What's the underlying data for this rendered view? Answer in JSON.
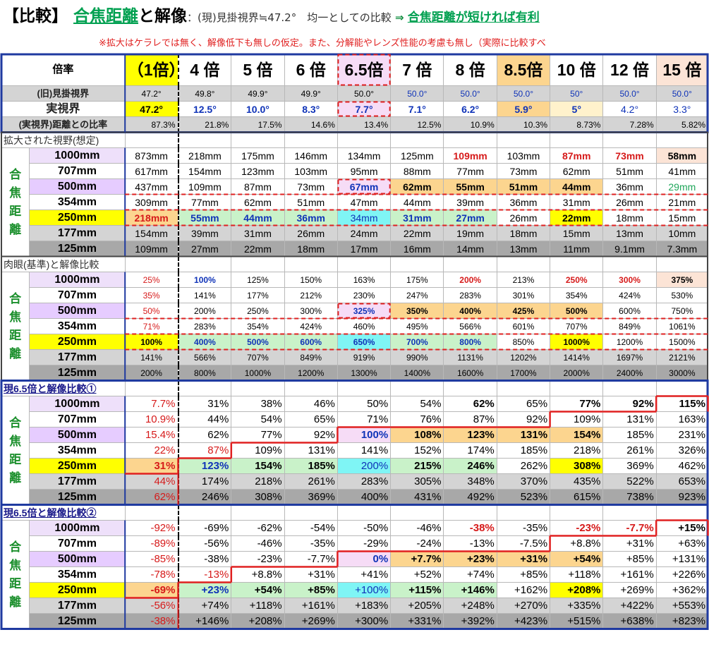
{
  "title": {
    "open": "【",
    "tag": "比較",
    "close": "】",
    "focal": "合焦距離",
    "and": "と",
    "res": "解像",
    "note": "：(現)見掛視界≒47.2°　均一としての比較",
    "arrow": " ⇒ ",
    "win": "合焦距離が短ければ有利"
  },
  "subtitle": "※拡大はケラレでは無く、解像低下も無しの仮定。また、分解能やレンズ性能の考慮も無し（実際に比較すべ",
  "colors": {
    "blue_frame": "#1f3aa0",
    "red_line": "#e02020",
    "green_label": "#1b8f2c"
  },
  "focal_label": [
    "合",
    "焦",
    "距",
    "離"
  ],
  "header": {
    "label": "倍率",
    "cols": [
      "（1倍）",
      "4 倍",
      "5 倍",
      "6 倍",
      "6.5倍",
      "7 倍",
      "8 倍",
      "8.5倍",
      "10 倍",
      "12 倍",
      "15 倍"
    ]
  },
  "info_rows": [
    {
      "label": "(旧)見掛視界",
      "cells": [
        "47.2°",
        "49.8°",
        "49.9°",
        "49.9°",
        "50.0°",
        "50.0°",
        "50.0°",
        "50.0°",
        "50°",
        "50.0°",
        "50.0°"
      ]
    },
    {
      "label": "実視界",
      "cells": [
        "47.2°",
        "12.5°",
        "10.0°",
        "8.3°",
        "7.7°",
        "7.1°",
        "6.2°",
        "5.9°",
        "5°",
        "4.2°",
        "3.3°"
      ]
    },
    {
      "label": "(実視界)距離との比率",
      "cells": [
        "87.3%",
        "21.8%",
        "17.5%",
        "14.6%",
        "13.4%",
        "12.5%",
        "10.9%",
        "10.3%",
        "8.73%",
        "7.28%",
        "5.82%"
      ]
    }
  ],
  "distances": [
    "1000mm",
    "707mm",
    "500mm",
    "354mm",
    "250mm",
    "177mm",
    "125mm"
  ],
  "sections": [
    {
      "title": "拡大された視野(想定)",
      "rows": [
        [
          "873mm",
          "218mm",
          "175mm",
          "146mm",
          "134mm",
          "125mm",
          "109mm",
          "103mm",
          "87mm",
          "73mm",
          "58mm"
        ],
        [
          "617mm",
          "154mm",
          "123mm",
          "103mm",
          "95mm",
          "88mm",
          "77mm",
          "73mm",
          "62mm",
          "51mm",
          "41mm"
        ],
        [
          "437mm",
          "109mm",
          "87mm",
          "73mm",
          "67mm",
          "62mm",
          "55mm",
          "51mm",
          "44mm",
          "36mm",
          "29mm"
        ],
        [
          "309mm",
          "77mm",
          "62mm",
          "51mm",
          "47mm",
          "44mm",
          "39mm",
          "36mm",
          "31mm",
          "26mm",
          "21mm"
        ],
        [
          "218mm",
          "55mm",
          "44mm",
          "36mm",
          "34mm",
          "31mm",
          "27mm",
          "26mm",
          "22mm",
          "18mm",
          "15mm"
        ],
        [
          "154mm",
          "39mm",
          "31mm",
          "26mm",
          "24mm",
          "22mm",
          "19mm",
          "18mm",
          "15mm",
          "13mm",
          "10mm"
        ],
        [
          "109mm",
          "27mm",
          "22mm",
          "18mm",
          "17mm",
          "16mm",
          "14mm",
          "13mm",
          "11mm",
          "9.1mm",
          "7.3mm"
        ]
      ]
    },
    {
      "title": "肉眼(基準)と解像比較",
      "rows": [
        [
          "25%",
          "100%",
          "125%",
          "150%",
          "163%",
          "175%",
          "200%",
          "213%",
          "250%",
          "300%",
          "375%"
        ],
        [
          "35%",
          "141%",
          "177%",
          "212%",
          "230%",
          "247%",
          "283%",
          "301%",
          "354%",
          "424%",
          "530%"
        ],
        [
          "50%",
          "200%",
          "250%",
          "300%",
          "325%",
          "350%",
          "400%",
          "425%",
          "500%",
          "600%",
          "750%"
        ],
        [
          "71%",
          "283%",
          "354%",
          "424%",
          "460%",
          "495%",
          "566%",
          "601%",
          "707%",
          "849%",
          "1061%"
        ],
        [
          "100%",
          "400%",
          "500%",
          "600%",
          "650%",
          "700%",
          "800%",
          "850%",
          "1000%",
          "1200%",
          "1500%"
        ],
        [
          "141%",
          "566%",
          "707%",
          "849%",
          "919%",
          "990%",
          "1131%",
          "1202%",
          "1414%",
          "1697%",
          "2121%"
        ],
        [
          "200%",
          "800%",
          "1000%",
          "1200%",
          "1300%",
          "1400%",
          "1600%",
          "1700%",
          "2000%",
          "2400%",
          "3000%"
        ]
      ]
    },
    {
      "title": "現6.5倍と解像比較①",
      "rows": [
        [
          "7.7%",
          "31%",
          "38%",
          "46%",
          "50%",
          "54%",
          "62%",
          "65%",
          "77%",
          "92%",
          "115%"
        ],
        [
          "10.9%",
          "44%",
          "54%",
          "65%",
          "71%",
          "76%",
          "87%",
          "92%",
          "109%",
          "131%",
          "163%"
        ],
        [
          "15.4%",
          "62%",
          "77%",
          "92%",
          "100%",
          "108%",
          "123%",
          "131%",
          "154%",
          "185%",
          "231%"
        ],
        [
          "22%",
          "87%",
          "109%",
          "131%",
          "141%",
          "152%",
          "174%",
          "185%",
          "218%",
          "261%",
          "326%"
        ],
        [
          "31%",
          "123%",
          "154%",
          "185%",
          "200%",
          "215%",
          "246%",
          "262%",
          "308%",
          "369%",
          "462%"
        ],
        [
          "44%",
          "174%",
          "218%",
          "261%",
          "283%",
          "305%",
          "348%",
          "370%",
          "435%",
          "522%",
          "653%"
        ],
        [
          "62%",
          "246%",
          "308%",
          "369%",
          "400%",
          "431%",
          "492%",
          "523%",
          "615%",
          "738%",
          "923%"
        ]
      ]
    },
    {
      "title": "現6.5倍と解像比較②",
      "rows": [
        [
          "-92%",
          "-69%",
          "-62%",
          "-54%",
          "-50%",
          "-46%",
          "-38%",
          "-35%",
          "-23%",
          "-7.7%",
          "+15%"
        ],
        [
          "-89%",
          "-56%",
          "-46%",
          "-35%",
          "-29%",
          "-24%",
          "-13%",
          "-7.5%",
          "+8.8%",
          "+31%",
          "+63%"
        ],
        [
          "-85%",
          "-38%",
          "-23%",
          "-7.7%",
          "0%",
          "+7.7%",
          "+23%",
          "+31%",
          "+54%",
          "+85%",
          "+131%"
        ],
        [
          "-78%",
          "-13%",
          "+8.8%",
          "+31%",
          "+41%",
          "+52%",
          "+74%",
          "+85%",
          "+118%",
          "+161%",
          "+226%"
        ],
        [
          "-69%",
          "+23%",
          "+54%",
          "+85%",
          "+100%",
          "+115%",
          "+146%",
          "+162%",
          "+208%",
          "+269%",
          "+362%"
        ],
        [
          "-56%",
          "+74%",
          "+118%",
          "+161%",
          "+183%",
          "+205%",
          "+248%",
          "+270%",
          "+335%",
          "+422%",
          "+553%"
        ],
        [
          "-38%",
          "+146%",
          "+208%",
          "+269%",
          "+300%",
          "+331%",
          "+392%",
          "+423%",
          "+515%",
          "+638%",
          "+823%"
        ]
      ]
    }
  ]
}
